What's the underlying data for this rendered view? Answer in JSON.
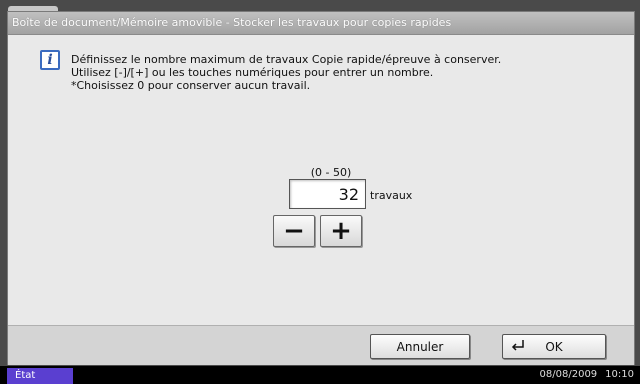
{
  "window": {
    "title": "Boîte de document/Mémoire amovible - Stocker les travaux pour copies rapides"
  },
  "message": {
    "icon": "info-icon",
    "icon_glyph": "i",
    "line1": "Définissez le nombre maximum de travaux Copie rapide/épreuve à conserver.",
    "line2": "Utilisez [-]/[+] ou les touches numériques pour entrer un nombre.",
    "line3": "*Choisissez 0 pour conserver aucun travail."
  },
  "input": {
    "range_label": "(0 - 50)",
    "value": "32",
    "unit": "travaux",
    "minus_label": "−",
    "plus_label": "+"
  },
  "actions": {
    "cancel_label": "Annuler",
    "ok_label": "OK"
  },
  "statusbar": {
    "status_label": "État",
    "date": "08/08/2009",
    "time": "10:10"
  },
  "colors": {
    "status_button": "#5a3fd0",
    "info_icon_border": "#3a6bc0"
  }
}
